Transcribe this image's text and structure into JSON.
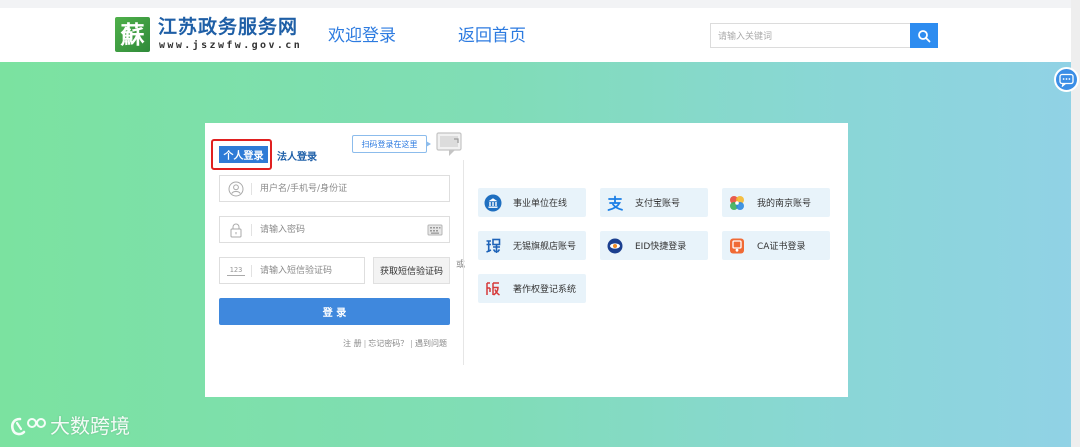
{
  "header": {
    "logo_char": "蘇",
    "site_name": "江苏政务服务网",
    "site_url": "www.jszwfw.gov.cn",
    "nav": [
      {
        "label": "欢迎登录"
      },
      {
        "label": "返回首页"
      }
    ],
    "search": {
      "placeholder": "请输入关键词",
      "icon": "search-icon"
    }
  },
  "login": {
    "tabs": [
      {
        "label": "个人登录",
        "active": true
      },
      {
        "label": "法人登录",
        "active": false
      }
    ],
    "qr_tip": "扫码登录在这里",
    "fields": {
      "username": {
        "placeholder": "用户名/手机号/身份证",
        "icon": "user-icon"
      },
      "password": {
        "placeholder": "请输入密码",
        "icon": "lock-icon"
      },
      "sms": {
        "placeholder": "请输入短信验证码",
        "icon_text": "123",
        "button": "获取短信验证码"
      }
    },
    "submit": "登 录",
    "links": [
      {
        "label": "注 册"
      },
      {
        "label": "忘记密码？"
      },
      {
        "label": "遇到问题"
      }
    ],
    "link_separator": "|",
    "or": "或"
  },
  "alt_logins": [
    {
      "label": "事业单位在线",
      "icon": "building-icon"
    },
    {
      "label": "支付宝账号",
      "icon": "alipay-icon"
    },
    {
      "label": "我的南京账号",
      "icon": "nanjing-icon"
    },
    {
      "label": "无锡旗舰店账号",
      "icon": "wuxi-icon"
    },
    {
      "label": "EID快捷登录",
      "icon": "eid-icon"
    },
    {
      "label": "CA证书登录",
      "icon": "ca-certificate-icon"
    },
    {
      "label": "著作权登记系统",
      "icon": "copyright-icon"
    }
  ],
  "watermark": "大数跨境",
  "colors": {
    "accent": "#2d7be0",
    "login_button": "#3f88dd",
    "highlight_border": "#e02020",
    "bg_left": "#7be2a0",
    "bg_right": "#91d2e6",
    "alt_button_bg": "#e8f3fa"
  }
}
